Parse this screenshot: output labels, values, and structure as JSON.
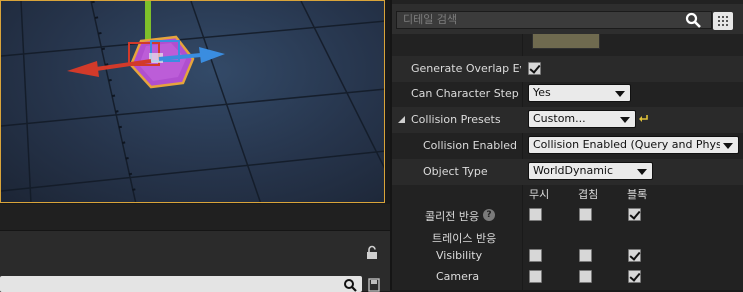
{
  "details_panel": {
    "search_placeholder": "디테일 검색",
    "properties": {
      "generate_overlap_label": "Generate Overlap Ever",
      "generate_overlap_checked": true,
      "can_step_up_label": "Can Character Step Up",
      "can_step_up_value": "Yes",
      "collision_presets_label": "Collision Presets",
      "collision_presets_value": "Custom...",
      "collision_enabled_label": "Collision Enabled",
      "collision_enabled_value": "Collision Enabled (Query and Physics)",
      "object_type_label": "Object Type",
      "object_type_value": "WorldDynamic"
    },
    "response_columns": [
      "무시",
      "겹침",
      "블록"
    ],
    "collision_response_label": "콜리전 반응",
    "trace_response_label": "트레이스 반응",
    "responses": [
      {
        "label": "콜리전 반응",
        "ignore": false,
        "overlap": false,
        "block": true
      },
      {
        "label": "Visibility",
        "ignore": false,
        "overlap": false,
        "block": true
      },
      {
        "label": "Camera",
        "ignore": false,
        "overlap": false,
        "block": true
      }
    ]
  },
  "colors": {
    "viewport_border": "#d9a43a",
    "gizmo_x": "#d23a2a",
    "gizmo_y": "#3a8de0",
    "gizmo_z": "#7fc02a",
    "selected_mesh": "#b04fcf"
  },
  "icons": [
    "search-icon",
    "grid-view-icon",
    "lock-icon",
    "save-icon",
    "reset-to-default-icon",
    "help-icon",
    "expand-arrow-icon"
  ]
}
